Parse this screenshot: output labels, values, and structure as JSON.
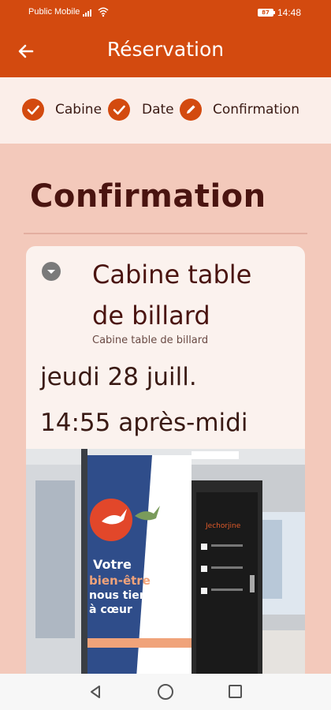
{
  "status_bar": {
    "carrier": "Public Mobile",
    "battery": "87",
    "time": "14:48"
  },
  "app_bar": {
    "title": "Réservation",
    "back_icon": "arrow-left-icon"
  },
  "stepper": {
    "steps": [
      {
        "label": "Cabine",
        "icon": "check-circle-icon"
      },
      {
        "label": "Date",
        "icon": "check-circle-icon"
      },
      {
        "label": "Confirmation",
        "icon": "pencil-circle-icon"
      }
    ]
  },
  "main": {
    "section_title": "Confirmation",
    "card": {
      "title": "Cabine table de billard",
      "subtitle": "Cabine table de billard",
      "date": "jeudi 28 juill.",
      "time": "14:55 après-midi",
      "collapse_icon": "chevron-down-circle-icon",
      "photo": {
        "sign_line1": "Votre",
        "sign_line2": "bien-être",
        "sign_line3": "nous tient",
        "sign_line4": "à cœur",
        "door_brand": "Jechorjine"
      }
    }
  },
  "nav_bar": {
    "back_icon": "triangle-back-icon",
    "home_icon": "circle-home-icon",
    "recent_icon": "square-recent-icon"
  },
  "colors": {
    "primary": "#d34a0f",
    "background": "#f3c9bb",
    "stepper_bg": "#fbeee9",
    "card_bg": "#fbf2ee",
    "title_text": "#4a1410"
  }
}
